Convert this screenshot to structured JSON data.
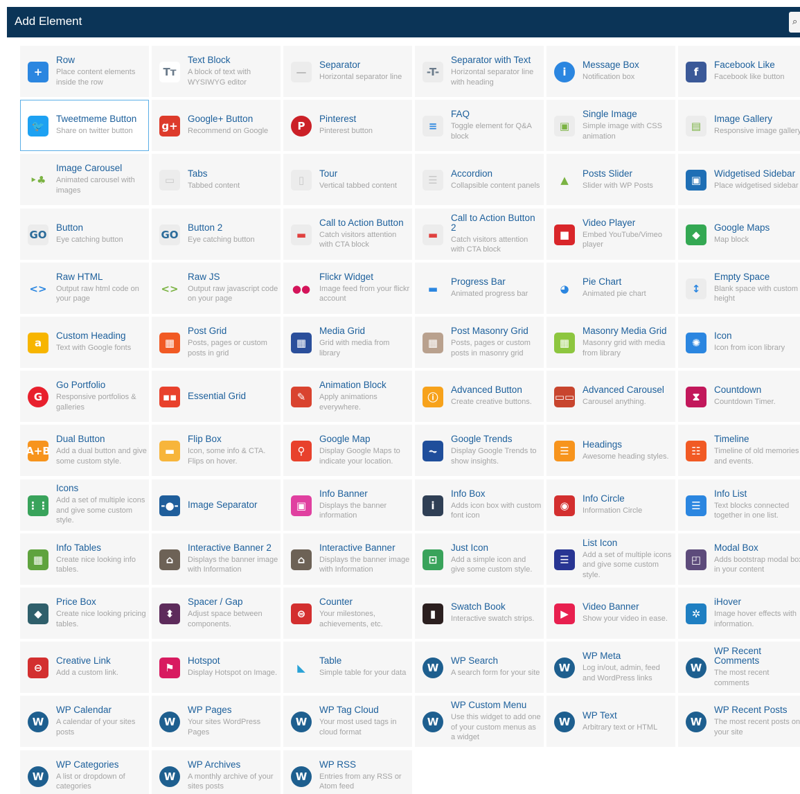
{
  "header": {
    "title": "Add Element",
    "search_icon": "search-icon"
  },
  "elements": [
    {
      "title": "Row",
      "desc": "Place content elements inside the row",
      "icon": "plus-icon",
      "color": "#2b86e0",
      "glyph": "+"
    },
    {
      "title": "Text Block",
      "desc": "A block of text with WYSIWYG editor",
      "icon": "text-icon",
      "color": "#ffffff",
      "glyph": "Tт",
      "fg": "#6b7b8b"
    },
    {
      "title": "Separator",
      "desc": "Horizontal separator line",
      "icon": "separator-icon",
      "color": "#ececec",
      "glyph": "—",
      "fg": "#bbbbbb"
    },
    {
      "title": "Separator with Text",
      "desc": "Horizontal separator line with heading",
      "icon": "separator-text-icon",
      "color": "#ececec",
      "glyph": "-T-",
      "fg": "#6b7b8b"
    },
    {
      "title": "Message Box",
      "desc": "Notification box",
      "icon": "info-icon",
      "color": "#2b86e0",
      "glyph": "i",
      "round": true
    },
    {
      "title": "Facebook Like",
      "desc": "Facebook like button",
      "icon": "facebook-icon",
      "color": "#3b5998",
      "glyph": "f"
    },
    {
      "title": "Tweetmeme Button",
      "desc": "Share on twitter button",
      "icon": "twitter-icon",
      "color": "#1da1f2",
      "glyph": "🐦",
      "selected": true
    },
    {
      "title": "Google+ Button",
      "desc": "Recommend on Google",
      "icon": "google-plus-icon",
      "color": "#dd3b2b",
      "glyph": "g+"
    },
    {
      "title": "Pinterest",
      "desc": "Pinterest button",
      "icon": "pinterest-icon",
      "color": "#cb2027",
      "glyph": "P",
      "round": true
    },
    {
      "title": "FAQ",
      "desc": "Toggle element for Q&A block",
      "icon": "faq-icon",
      "color": "#ececec",
      "glyph": "≡",
      "fg": "#2b86e0"
    },
    {
      "title": "Single Image",
      "desc": "Simple image with CSS animation",
      "icon": "image-icon",
      "color": "#ececec",
      "glyph": "▣",
      "fg": "#7bb343"
    },
    {
      "title": "Image Gallery",
      "desc": "Responsive image gallery",
      "icon": "gallery-icon",
      "color": "#ececec",
      "glyph": "▤",
      "fg": "#7bb343"
    },
    {
      "title": "Image Carousel",
      "desc": "Animated carousel with images",
      "icon": "carousel-icon",
      "color": "#f6f6f6",
      "glyph": "‣♣",
      "fg": "#7bb343"
    },
    {
      "title": "Tabs",
      "desc": "Tabbed content",
      "icon": "tabs-icon",
      "color": "#ececec",
      "glyph": "▭",
      "fg": "#c8c8c8"
    },
    {
      "title": "Tour",
      "desc": "Vertical tabbed content",
      "icon": "tour-icon",
      "color": "#ececec",
      "glyph": "▯",
      "fg": "#c8c8c8"
    },
    {
      "title": "Accordion",
      "desc": "Collapsible content panels",
      "icon": "accordion-icon",
      "color": "#ececec",
      "glyph": "☰",
      "fg": "#c8c8c8"
    },
    {
      "title": "Posts Slider",
      "desc": "Slider with WP Posts",
      "icon": "posts-slider-icon",
      "color": "#f6f6f6",
      "glyph": "▲",
      "fg": "#7bb343"
    },
    {
      "title": "Widgetised Sidebar",
      "desc": "Place widgetised sidebar",
      "icon": "sidebar-icon",
      "color": "#1f6fb5",
      "glyph": "▣"
    },
    {
      "title": "Button",
      "desc": "Eye catching button",
      "icon": "button-icon",
      "color": "#ececec",
      "glyph": "GO",
      "fg": "#2b6b9a"
    },
    {
      "title": "Button 2",
      "desc": "Eye catching button",
      "icon": "button2-icon",
      "color": "#ececec",
      "glyph": "GO",
      "fg": "#2b6b9a"
    },
    {
      "title": "Call to Action Button",
      "desc": "Catch visitors attention with CTA block",
      "icon": "cta-icon",
      "color": "#ececec",
      "glyph": "▬",
      "fg": "#e0413f"
    },
    {
      "title": "Call to Action Button 2",
      "desc": "Catch visitors attention with CTA block",
      "icon": "cta2-icon",
      "color": "#ececec",
      "glyph": "▬",
      "fg": "#e0413f"
    },
    {
      "title": "Video Player",
      "desc": "Embed YouTube/Vimeo player",
      "icon": "video-icon",
      "color": "#d9262a",
      "glyph": "■"
    },
    {
      "title": "Google Maps",
      "desc": "Map block",
      "icon": "map-icon",
      "color": "#34a853",
      "glyph": "◆"
    },
    {
      "title": "Raw HTML",
      "desc": "Output raw html code on your page",
      "icon": "html-icon",
      "color": "#f6f6f6",
      "glyph": "<>",
      "fg": "#2b86e0"
    },
    {
      "title": "Raw JS",
      "desc": "Output raw javascript code on your page",
      "icon": "js-icon",
      "color": "#f6f6f6",
      "glyph": "<>",
      "fg": "#7bb343"
    },
    {
      "title": "Flickr Widget",
      "desc": "Image feed from your flickr account",
      "icon": "flickr-icon",
      "color": "#f6f6f6",
      "glyph": "●●",
      "fg": "#d4145a"
    },
    {
      "title": "Progress Bar",
      "desc": "Animated progress bar",
      "icon": "progress-icon",
      "color": "#f6f6f6",
      "glyph": "▬",
      "fg": "#2b86e0"
    },
    {
      "title": "Pie Chart",
      "desc": "Animated pie chart",
      "icon": "pie-chart-icon",
      "color": "#f6f6f6",
      "glyph": "◕",
      "fg": "#2b86e0"
    },
    {
      "title": "Empty Space",
      "desc": "Blank space with custom height",
      "icon": "empty-space-icon",
      "color": "#ececec",
      "glyph": "↕",
      "fg": "#2b86e0"
    },
    {
      "title": "Custom Heading",
      "desc": "Text with Google fonts",
      "icon": "heading-icon",
      "color": "#f7b500",
      "glyph": "a"
    },
    {
      "title": "Post Grid",
      "desc": "Posts, pages or custom posts in grid",
      "icon": "post-grid-icon",
      "color": "#f15a24",
      "glyph": "▦"
    },
    {
      "title": "Media Grid",
      "desc": "Grid with media from library",
      "icon": "media-grid-icon",
      "color": "#2b4f9b",
      "glyph": "▦"
    },
    {
      "title": "Post Masonry Grid",
      "desc": "Posts, pages or custom posts in masonry grid",
      "icon": "masonry-icon",
      "color": "#b9a18e",
      "glyph": "▦"
    },
    {
      "title": "Masonry Media Grid",
      "desc": "Masonry grid with media from library",
      "icon": "masonry-media-icon",
      "color": "#8dc63f",
      "glyph": "▦"
    },
    {
      "title": "Icon",
      "desc": "Icon from icon library",
      "icon": "icon-library-icon",
      "color": "#2b86e0",
      "glyph": "✺"
    },
    {
      "title": "Go Portfolio",
      "desc": "Responsive portfolios & galleries",
      "icon": "portfolio-icon",
      "color": "#e8202d",
      "glyph": "G",
      "round": true
    },
    {
      "title": "Essential Grid",
      "desc": "",
      "icon": "essential-grid-icon",
      "color": "#e8412c",
      "glyph": "▪▪"
    },
    {
      "title": "Animation Block",
      "desc": "Apply animations everywhere.",
      "icon": "animation-icon",
      "color": "#d9432f",
      "glyph": "✎"
    },
    {
      "title": "Advanced Button",
      "desc": "Create creative buttons.",
      "icon": "advanced-button-icon",
      "color": "#f7a21b",
      "glyph": "ⓘ"
    },
    {
      "title": "Advanced Carousel",
      "desc": "Carousel anything.",
      "icon": "advanced-carousel-icon",
      "color": "#c8452e",
      "glyph": "▭▭"
    },
    {
      "title": "Countdown",
      "desc": "Countdown Timer.",
      "icon": "countdown-icon",
      "color": "#c2185b",
      "glyph": "⧗"
    },
    {
      "title": "Dual Button",
      "desc": "Add a dual button and give some custom style.",
      "icon": "dual-button-icon",
      "color": "#f7941d",
      "glyph": "A+B"
    },
    {
      "title": "Flip Box",
      "desc": "Icon, some info & CTA. Flips on hover.",
      "icon": "flip-box-icon",
      "color": "#f7b53b",
      "glyph": "▬"
    },
    {
      "title": "Google Map",
      "desc": "Display Google Maps to indicate your location.",
      "icon": "map-pin-icon",
      "color": "#e8412c",
      "glyph": "⚲"
    },
    {
      "title": "Google Trends",
      "desc": "Display Google Trends to show insights.",
      "icon": "trends-icon",
      "color": "#1f4e9b",
      "glyph": "⏦"
    },
    {
      "title": "Headings",
      "desc": "Awesome heading styles.",
      "icon": "headings-icon",
      "color": "#f7941d",
      "glyph": "☰"
    },
    {
      "title": "Timeline",
      "desc": "Timeline of old memories and events.",
      "icon": "timeline-icon",
      "color": "#f15a24",
      "glyph": "☷"
    },
    {
      "title": "Icons",
      "desc": "Add a set of multiple icons and give some custom style.",
      "icon": "icons-icon",
      "color": "#39a35b",
      "glyph": "⋮⋮"
    },
    {
      "title": "Image Separator",
      "desc": "",
      "icon": "image-separator-icon",
      "color": "#1f5e9b",
      "glyph": "-●-"
    },
    {
      "title": "Info Banner",
      "desc": "Displays the banner information",
      "icon": "info-banner-icon",
      "color": "#e040a0",
      "glyph": "▣"
    },
    {
      "title": "Info Box",
      "desc": "Adds icon box with custom font icon",
      "icon": "info-box-icon",
      "color": "#2f3f55",
      "glyph": "i"
    },
    {
      "title": "Info Circle",
      "desc": "Information Circle",
      "icon": "info-circle-icon",
      "color": "#d32f2f",
      "glyph": "◉"
    },
    {
      "title": "Info List",
      "desc": "Text blocks connected together in one list.",
      "icon": "info-list-icon",
      "color": "#2b86e0",
      "glyph": "☰"
    },
    {
      "title": "Info Tables",
      "desc": "Create nice looking info tables.",
      "icon": "info-tables-icon",
      "color": "#5fa33e",
      "glyph": "▦"
    },
    {
      "title": "Interactive Banner 2",
      "desc": "Displays the banner image with Information",
      "icon": "interactive-banner2-icon",
      "color": "#6d6256",
      "glyph": "⌂"
    },
    {
      "title": "Interactive Banner",
      "desc": "Displays the banner image with Information",
      "icon": "interactive-banner-icon",
      "color": "#6d6256",
      "glyph": "⌂"
    },
    {
      "title": "Just Icon",
      "desc": "Add a simple icon and give some custom style.",
      "icon": "just-icon-icon",
      "color": "#39a35b",
      "glyph": "⊡"
    },
    {
      "title": "List Icon",
      "desc": "Add a set of multiple icons and give some custom style.",
      "icon": "list-icon-icon",
      "color": "#283593",
      "glyph": "☰"
    },
    {
      "title": "Modal Box",
      "desc": "Adds bootstrap modal box in your content",
      "icon": "modal-box-icon",
      "color": "#5d4b7b",
      "glyph": "◰"
    },
    {
      "title": "Price Box",
      "desc": "Create nice looking pricing tables.",
      "icon": "price-box-icon",
      "color": "#2f5f6b",
      "glyph": "◆"
    },
    {
      "title": "Spacer / Gap",
      "desc": "Adjust space between components.",
      "icon": "spacer-icon",
      "color": "#5d2b5b",
      "glyph": "⬍"
    },
    {
      "title": "Counter",
      "desc": "Your milestones, achievements, etc.",
      "icon": "counter-icon",
      "color": "#d32f2f",
      "glyph": "⊜"
    },
    {
      "title": "Swatch Book",
      "desc": "Interactive swatch strips.",
      "icon": "swatch-book-icon",
      "color": "#2b1f1f",
      "glyph": "▮"
    },
    {
      "title": "Video Banner",
      "desc": "Show your video in ease.",
      "icon": "video-banner-icon",
      "color": "#e8204f",
      "glyph": "▶"
    },
    {
      "title": "iHover",
      "desc": "Image hover effects with information.",
      "icon": "ihover-icon",
      "color": "#1f7fc2",
      "glyph": "✲"
    },
    {
      "title": "Creative Link",
      "desc": "Add a custom link.",
      "icon": "creative-link-icon",
      "color": "#d32f2f",
      "glyph": "⊖"
    },
    {
      "title": "Hotspot",
      "desc": "Display Hotspot on Image.",
      "icon": "hotspot-icon",
      "color": "#d81b60",
      "glyph": "⚑"
    },
    {
      "title": "Table",
      "desc": "Simple table for your data",
      "icon": "table-icon",
      "color": "#f6f6f6",
      "glyph": "◣",
      "fg": "#2aa2d6"
    },
    {
      "title": "WP Search",
      "desc": "A search form for your site",
      "icon": "wordpress-icon",
      "color": "#1e5f8f",
      "glyph": "W",
      "round": true
    },
    {
      "title": "WP Meta",
      "desc": "Log in/out, admin, feed and WordPress links",
      "icon": "wordpress-icon",
      "color": "#1e5f8f",
      "glyph": "W",
      "round": true
    },
    {
      "title": "WP Recent Comments",
      "desc": "The most recent comments",
      "icon": "wordpress-icon",
      "color": "#1e5f8f",
      "glyph": "W",
      "round": true
    },
    {
      "title": "WP Calendar",
      "desc": "A calendar of your sites posts",
      "icon": "wordpress-icon",
      "color": "#1e5f8f",
      "glyph": "W",
      "round": true
    },
    {
      "title": "WP Pages",
      "desc": "Your sites WordPress Pages",
      "icon": "wordpress-icon",
      "color": "#1e5f8f",
      "glyph": "W",
      "round": true
    },
    {
      "title": "WP Tag Cloud",
      "desc": "Your most used tags in cloud format",
      "icon": "wordpress-icon",
      "color": "#1e5f8f",
      "glyph": "W",
      "round": true
    },
    {
      "title": "WP Custom Menu",
      "desc": "Use this widget to add one of your custom menus as a widget",
      "icon": "wordpress-icon",
      "color": "#1e5f8f",
      "glyph": "W",
      "round": true
    },
    {
      "title": "WP Text",
      "desc": "Arbitrary text or HTML",
      "icon": "wordpress-icon",
      "color": "#1e5f8f",
      "glyph": "W",
      "round": true
    },
    {
      "title": "WP Recent Posts",
      "desc": "The most recent posts on your site",
      "icon": "wordpress-icon",
      "color": "#1e5f8f",
      "glyph": "W",
      "round": true
    },
    {
      "title": "WP Categories",
      "desc": "A list or dropdown of categories",
      "icon": "wordpress-icon",
      "color": "#1e5f8f",
      "glyph": "W",
      "round": true
    },
    {
      "title": "WP Archives",
      "desc": "A monthly archive of your sites posts",
      "icon": "wordpress-icon",
      "color": "#1e5f8f",
      "glyph": "W",
      "round": true
    },
    {
      "title": "WP RSS",
      "desc": "Entries from any RSS or Atom feed",
      "icon": "wordpress-icon",
      "color": "#1e5f8f",
      "glyph": "W",
      "round": true
    }
  ]
}
